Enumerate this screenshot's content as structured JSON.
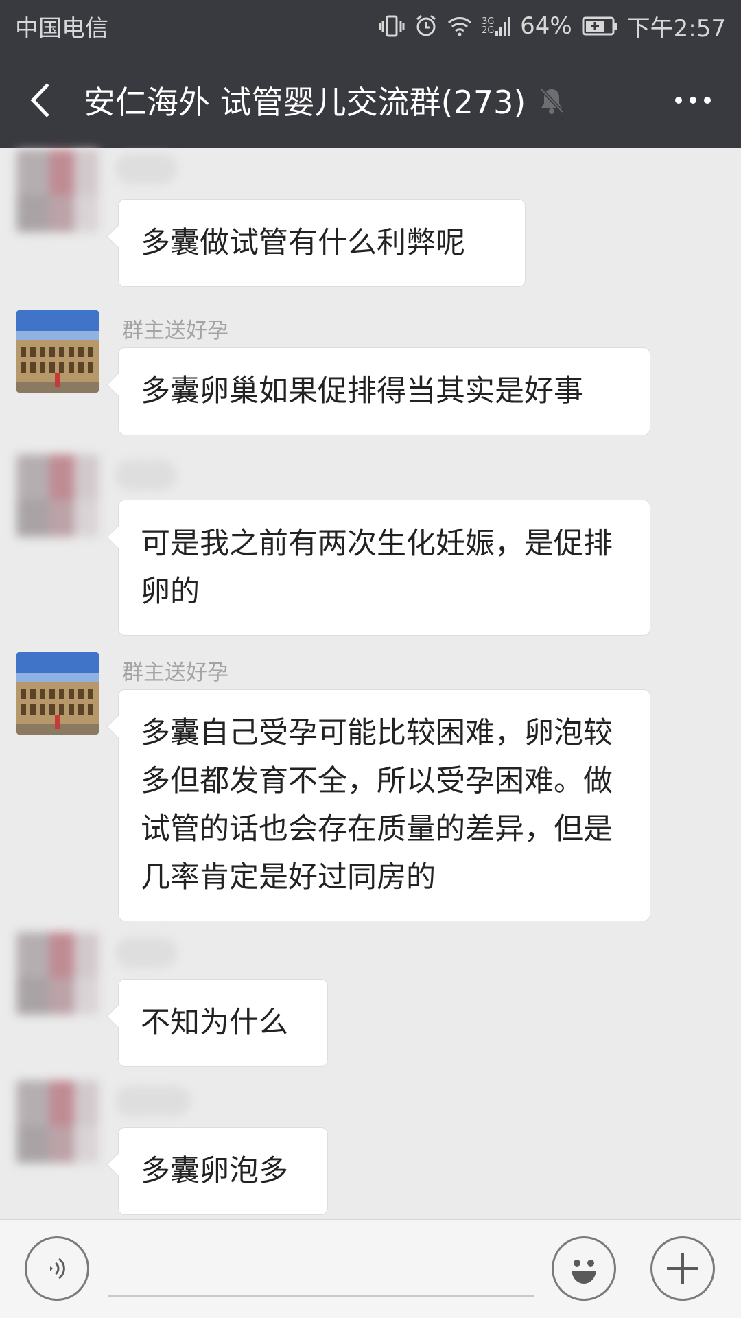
{
  "status_bar": {
    "carrier": "中国电信",
    "network": "3G 2G",
    "battery": "64%",
    "time": "下午2:57",
    "icons": [
      "vibrate-icon",
      "alarm-icon",
      "wifi-icon",
      "signal-icon",
      "battery-charging-icon"
    ]
  },
  "header": {
    "title": "安仁海外 试管婴儿交流群(273)",
    "icons": [
      "back-arrow-icon",
      "muted-bell-icon",
      "more-dots-icon"
    ]
  },
  "messages": [
    {
      "sender": "",
      "text": "多囊做试管有什么利弊呢",
      "avatar": "blurred"
    },
    {
      "sender": "群主送好孕",
      "text": "多囊卵巢如果促排得当其实是好事",
      "avatar": "colosseum-photo"
    },
    {
      "sender": "",
      "text": "可是我之前有两次生化妊娠，是促排卵的",
      "avatar": "blurred"
    },
    {
      "sender": "群主送好孕",
      "text": "多囊自己受孕可能比较困难，卵泡较多但都发育不全，所以受孕困难。做试管的话也会存在质量的差异，但是几率肯定是好过同房的",
      "avatar": "colosseum-photo"
    },
    {
      "sender": "",
      "text": "不知为什么",
      "avatar": "blurred"
    },
    {
      "sender": "",
      "text": "多囊卵泡多",
      "avatar": "blurred"
    }
  ],
  "input_bar": {
    "icons": [
      "voice-icon",
      "emoji-icon",
      "plus-icon"
    ]
  },
  "colors": {
    "header_bg": "#393a3f",
    "chat_bg": "#ebebeb",
    "bubble_bg": "#ffffff",
    "name_text": "#a3a3a3"
  }
}
